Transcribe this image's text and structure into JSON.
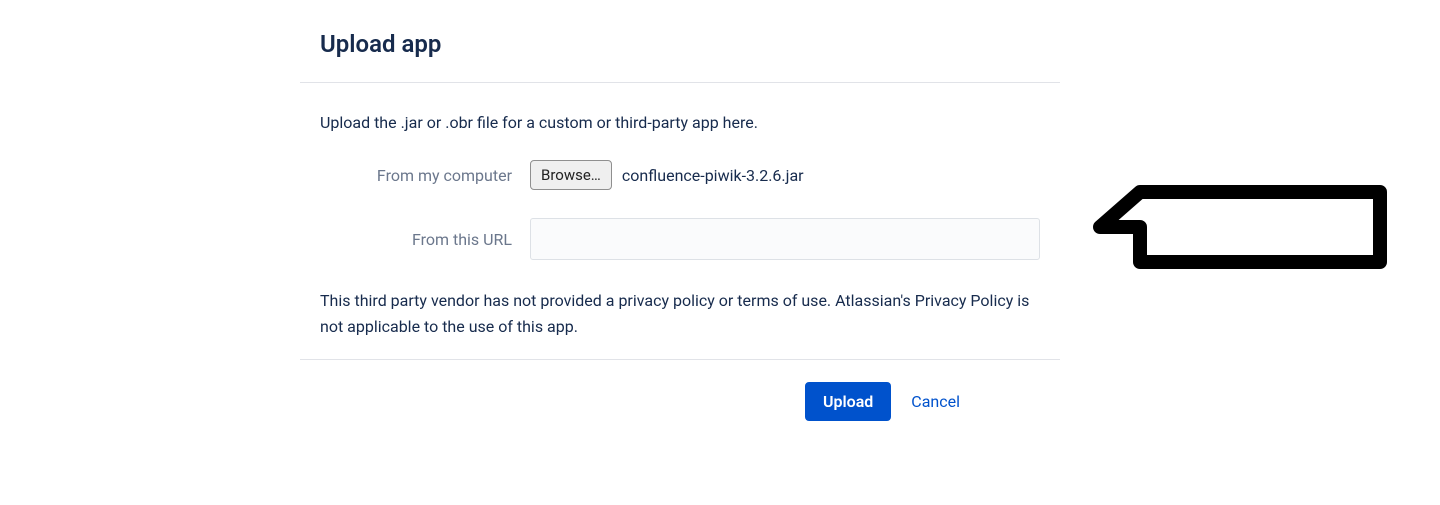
{
  "dialog": {
    "title": "Upload app",
    "instruction": "Upload the .jar or .obr file for a custom or third-party app here.",
    "fromComputerLabel": "From my computer",
    "browseLabel": "Browse…",
    "selectedFilename": "confluence-piwik-3.2.6.jar",
    "fromUrlLabel": "From this URL",
    "urlValue": "",
    "privacyNote": "This third party vendor has not provided a privacy policy or terms of use. Atlassian's Privacy Policy is not applicable to the use of this app.",
    "uploadLabel": "Upload",
    "cancelLabel": "Cancel"
  }
}
